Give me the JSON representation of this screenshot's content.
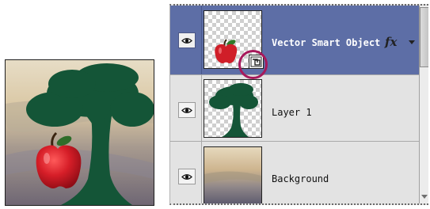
{
  "preview": {
    "icons": [
      "apple-icon",
      "tree-silhouette-icon"
    ]
  },
  "layers_panel": {
    "layers": [
      {
        "name": "Vector Smart Object",
        "visible": true,
        "selected": true,
        "has_effects": true,
        "effects_label": "fx",
        "smart_object": true
      },
      {
        "name": "Layer 1",
        "visible": true,
        "selected": false
      },
      {
        "name": "Background",
        "visible": true,
        "selected": false
      }
    ],
    "icons": {
      "visibility": "eye-icon",
      "effects": "fx-icon",
      "smart_object_badge": "smart-object-icon",
      "expand": "chevron-down-icon"
    }
  },
  "colors": {
    "selection": "#5d6ea6",
    "panel_bg": "#e3e3e3",
    "tree_green": "#145537",
    "apple_red": "#c81c26",
    "highlight_ring": "#a7195b"
  }
}
